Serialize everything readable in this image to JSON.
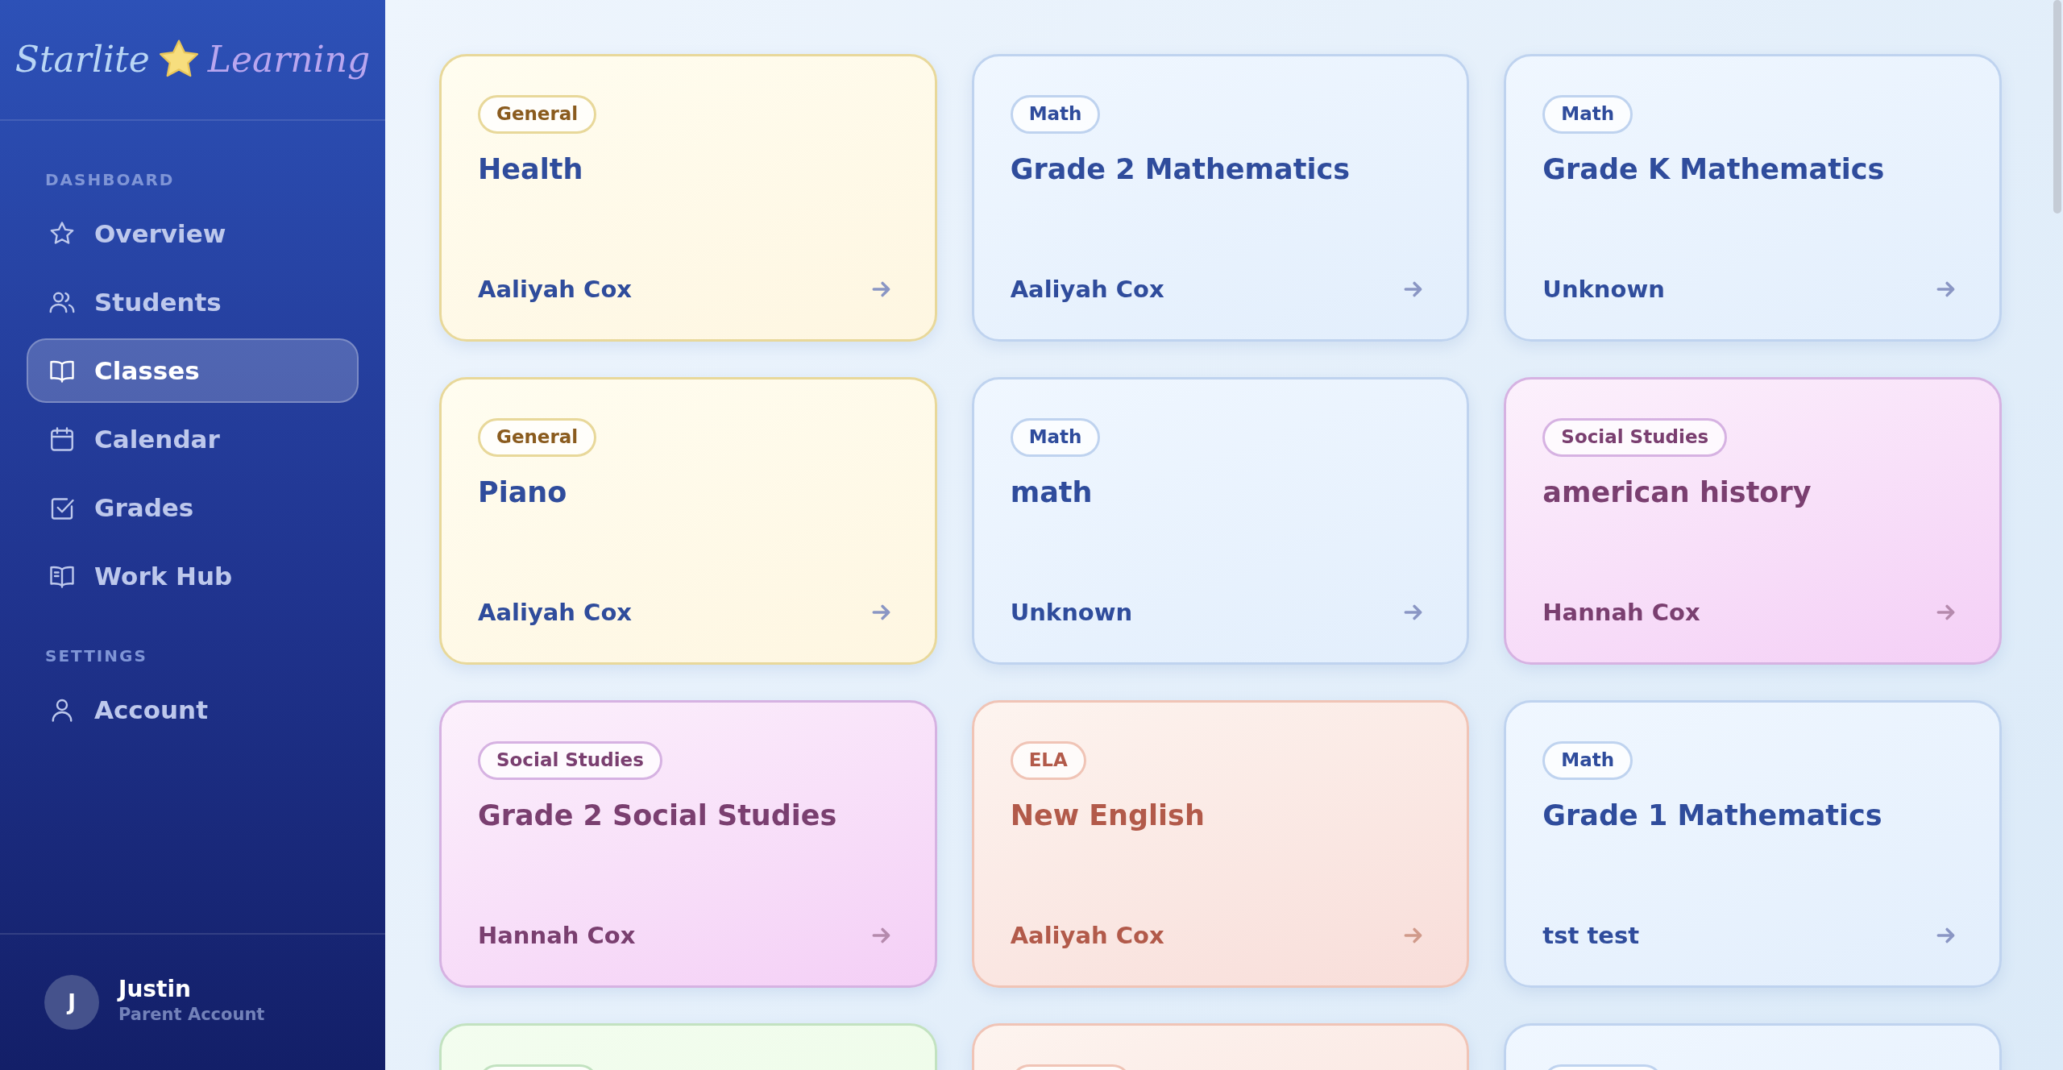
{
  "brand": {
    "first": "Starlite",
    "second": "Learning"
  },
  "sidebar": {
    "sections": [
      {
        "heading": "DASHBOARD",
        "items": [
          {
            "label": "Overview",
            "kind": "star",
            "selected": false
          },
          {
            "label": "Students",
            "kind": "users",
            "selected": false
          },
          {
            "label": "Classes",
            "kind": "book",
            "selected": true
          },
          {
            "label": "Calendar",
            "kind": "calendar",
            "selected": false
          },
          {
            "label": "Grades",
            "kind": "check",
            "selected": false
          },
          {
            "label": "Work Hub",
            "kind": "hub",
            "selected": false
          }
        ]
      },
      {
        "heading": "SETTINGS",
        "items": [
          {
            "label": "Account",
            "kind": "user",
            "selected": false
          }
        ]
      }
    ]
  },
  "user": {
    "initial": "J",
    "name": "Justin",
    "role": "Parent Account"
  },
  "classes": [
    {
      "kind": "card",
      "subject": "General",
      "title": "Health",
      "teacher": "Aaliyah Cox",
      "color": "#e8d89a"
    },
    {
      "kind": "card",
      "subject": "Math",
      "title": "Grade 2 Mathematics",
      "teacher": "Aaliyah Cox",
      "color": "#bfd3ef"
    },
    {
      "kind": "card",
      "subject": "Math",
      "title": "Grade K Mathematics",
      "teacher": "Unknown",
      "color": "#bfd3ef"
    },
    {
      "kind": "card",
      "subject": "General",
      "title": "Piano",
      "teacher": "Aaliyah Cox",
      "color": "#e8d89a"
    },
    {
      "kind": "card",
      "subject": "Math",
      "title": "math",
      "teacher": "Unknown",
      "color": "#bfd3ef"
    },
    {
      "kind": "card",
      "subject": "Social Studies",
      "title": "american history",
      "teacher": "Hannah Cox",
      "color": "#d6b2e2"
    },
    {
      "kind": "card",
      "subject": "Social Studies",
      "title": "Grade 2 Social Studies",
      "teacher": "Hannah Cox",
      "color": "#d6b2e2"
    },
    {
      "kind": "card",
      "subject": "ELA",
      "title": "New English",
      "teacher": "Aaliyah Cox",
      "color": "#f0c4b6"
    },
    {
      "kind": "card",
      "subject": "Math",
      "title": "Grade 1 Mathematics",
      "teacher": "tst test",
      "color": "#bfd3ef"
    },
    {
      "kind": "cut",
      "color": "#c2e2c0"
    },
    {
      "kind": "cut",
      "color": "#f0c4b6"
    },
    {
      "kind": "cut",
      "color": "#bfd3ef"
    }
  ]
}
